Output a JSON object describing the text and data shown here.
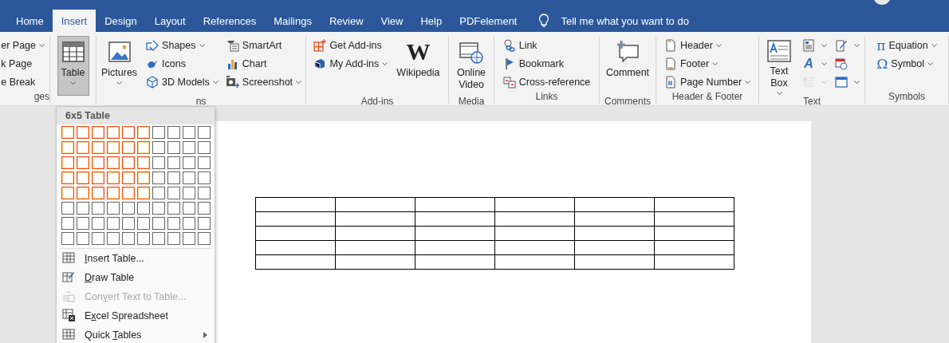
{
  "tabs": [
    {
      "label": "Home",
      "selected": false
    },
    {
      "label": "Insert",
      "selected": true
    },
    {
      "label": "Design",
      "selected": false
    },
    {
      "label": "Layout",
      "selected": false
    },
    {
      "label": "References",
      "selected": false
    },
    {
      "label": "Mailings",
      "selected": false
    },
    {
      "label": "Review",
      "selected": false
    },
    {
      "label": "View",
      "selected": false
    },
    {
      "label": "Help",
      "selected": false
    },
    {
      "label": "PDFelement",
      "selected": false
    }
  ],
  "tell_me": {
    "placeholder": "Tell me what you want to do"
  },
  "ribbon": {
    "groups": [
      {
        "label": "ges",
        "columns": [
          [
            {
              "kind": "small",
              "label": "er Page",
              "dropdown": true
            },
            {
              "kind": "small",
              "label": "k Page",
              "dropdown": false
            },
            {
              "kind": "small",
              "label": "e Break",
              "dropdown": false
            }
          ]
        ]
      },
      {
        "columns": [
          [
            {
              "kind": "large",
              "label": "Table",
              "dropdown": true,
              "pressed": true
            }
          ]
        ]
      },
      {
        "label": "ns",
        "columns": [
          [
            {
              "kind": "large",
              "label": "Pictures",
              "dropdown": true,
              "pressed": false
            }
          ],
          [
            {
              "kind": "small",
              "label": "Shapes",
              "dropdown": true
            },
            {
              "kind": "small",
              "label": "Icons",
              "dropdown": false
            },
            {
              "kind": "small",
              "label": "3D Models",
              "dropdown": true
            }
          ],
          [
            {
              "kind": "small",
              "label": "SmartArt",
              "dropdown": false
            },
            {
              "kind": "small",
              "label": "Chart",
              "dropdown": false
            },
            {
              "kind": "small",
              "label": "Screenshot",
              "dropdown": true
            }
          ]
        ]
      },
      {
        "label": "Add-ins",
        "columns": [
          [
            {
              "kind": "small",
              "label": "Get Add-ins",
              "dropdown": false
            },
            {
              "kind": "small",
              "label": "My Add-ins",
              "dropdown": true
            }
          ],
          [
            {
              "kind": "large",
              "label": "Wikipedia",
              "glyph": "W",
              "dropdown": false,
              "pressed": false
            }
          ]
        ]
      },
      {
        "label": "Media",
        "columns": [
          [
            {
              "kind": "large",
              "label": "Online Video",
              "dropdown": false,
              "pressed": false
            }
          ]
        ]
      },
      {
        "label": "Links",
        "columns": [
          [
            {
              "kind": "small",
              "label": "Link",
              "dropdown": false
            },
            {
              "kind": "small",
              "label": "Bookmark",
              "dropdown": false
            },
            {
              "kind": "small",
              "label": "Cross-reference",
              "dropdown": false
            }
          ]
        ]
      },
      {
        "label": "Comments",
        "columns": [
          [
            {
              "kind": "large",
              "label": "Comment",
              "dropdown": false,
              "pressed": false
            }
          ]
        ]
      },
      {
        "label": "Header & Footer",
        "columns": [
          [
            {
              "kind": "small",
              "label": "Header",
              "dropdown": true
            },
            {
              "kind": "small",
              "label": "Footer",
              "dropdown": true
            },
            {
              "kind": "small",
              "label": "Page Number",
              "dropdown": true
            }
          ]
        ]
      },
      {
        "label": "Text",
        "columns": [
          [
            {
              "kind": "large",
              "label": "Text Box",
              "dropdown": true,
              "pressed": false
            }
          ],
          [
            {
              "kind": "icon",
              "dropdown": true,
              "disabled": false
            },
            {
              "kind": "icon",
              "glyph": "A",
              "dropdown": true,
              "disabled": false
            },
            {
              "kind": "icon",
              "dropdown": true,
              "disabled": true
            }
          ],
          [
            {
              "kind": "icon",
              "dropdown": true,
              "disabled": false
            },
            {
              "kind": "icon",
              "dropdown": false,
              "disabled": false
            },
            {
              "kind": "icon",
              "dropdown": true,
              "disabled": false
            }
          ]
        ]
      },
      {
        "label": "Symbols",
        "columns": [
          [
            {
              "kind": "small",
              "label": "Equation",
              "glyph": "π",
              "dropdown": true
            },
            {
              "kind": "small",
              "label": "Symbol",
              "glyph": "Ω",
              "dropdown": true
            }
          ]
        ]
      }
    ]
  },
  "table_menu": {
    "title": "6x5 Table",
    "grid": [
      [
        {
          "selected": true
        },
        {
          "selected": true
        },
        {
          "selected": true
        },
        {
          "selected": true
        },
        {
          "selected": true
        },
        {
          "selected": true
        },
        {
          "selected": false
        },
        {
          "selected": false
        },
        {
          "selected": false
        },
        {
          "selected": false
        }
      ],
      [
        {
          "selected": true
        },
        {
          "selected": true
        },
        {
          "selected": true
        },
        {
          "selected": true
        },
        {
          "selected": true
        },
        {
          "selected": true
        },
        {
          "selected": false
        },
        {
          "selected": false
        },
        {
          "selected": false
        },
        {
          "selected": false
        }
      ],
      [
        {
          "selected": true
        },
        {
          "selected": true
        },
        {
          "selected": true
        },
        {
          "selected": true
        },
        {
          "selected": true
        },
        {
          "selected": true
        },
        {
          "selected": false
        },
        {
          "selected": false
        },
        {
          "selected": false
        },
        {
          "selected": false
        }
      ],
      [
        {
          "selected": true
        },
        {
          "selected": true
        },
        {
          "selected": true
        },
        {
          "selected": true
        },
        {
          "selected": true
        },
        {
          "selected": true
        },
        {
          "selected": false
        },
        {
          "selected": false
        },
        {
          "selected": false
        },
        {
          "selected": false
        }
      ],
      [
        {
          "selected": true
        },
        {
          "selected": true
        },
        {
          "selected": true
        },
        {
          "selected": true
        },
        {
          "selected": true
        },
        {
          "selected": true
        },
        {
          "selected": false
        },
        {
          "selected": false
        },
        {
          "selected": false
        },
        {
          "selected": false
        }
      ],
      [
        {
          "selected": false
        },
        {
          "selected": false
        },
        {
          "selected": false
        },
        {
          "selected": false
        },
        {
          "selected": false
        },
        {
          "selected": false
        },
        {
          "selected": false
        },
        {
          "selected": false
        },
        {
          "selected": false
        },
        {
          "selected": false
        }
      ],
      [
        {
          "selected": false
        },
        {
          "selected": false
        },
        {
          "selected": false
        },
        {
          "selected": false
        },
        {
          "selected": false
        },
        {
          "selected": false
        },
        {
          "selected": false
        },
        {
          "selected": false
        },
        {
          "selected": false
        },
        {
          "selected": false
        }
      ],
      [
        {
          "selected": false
        },
        {
          "selected": false
        },
        {
          "selected": false
        },
        {
          "selected": false
        },
        {
          "selected": false
        },
        {
          "selected": false
        },
        {
          "selected": false
        },
        {
          "selected": false
        },
        {
          "selected": false
        },
        {
          "selected": false
        }
      ]
    ],
    "items": [
      {
        "kind": "item",
        "key": "I",
        "after": "nsert Table...",
        "disabled": false
      },
      {
        "kind": "item",
        "key": "D",
        "after": "raw Table",
        "disabled": false
      },
      {
        "kind": "item",
        "before": "Con",
        "key": "v",
        "after": "ert Text to Table...",
        "disabled": true
      },
      {
        "kind": "item",
        "before": "E",
        "key": "x",
        "after": "cel Spreadsheet",
        "disabled": false
      },
      {
        "kind": "submenu",
        "before": "Quick ",
        "key": "T",
        "after": "ables",
        "disabled": false
      }
    ]
  },
  "document": {
    "table": [
      {
        "cells": [
          {
            "kind": "blank"
          },
          {
            "kind": "blank"
          },
          {
            "kind": "blank"
          },
          {
            "kind": "blank"
          },
          {
            "kind": "blank"
          },
          {
            "kind": "blank"
          }
        ]
      },
      {
        "cells": [
          {
            "kind": "blank"
          },
          {
            "kind": "blank"
          },
          {
            "kind": "blank"
          },
          {
            "kind": "blank"
          },
          {
            "kind": "blank"
          },
          {
            "kind": "blank"
          }
        ]
      },
      {
        "cells": [
          {
            "kind": "blank"
          },
          {
            "kind": "blank"
          },
          {
            "kind": "blank"
          },
          {
            "kind": "blank"
          },
          {
            "kind": "blank"
          },
          {
            "kind": "blank"
          }
        ]
      },
      {
        "cells": [
          {
            "kind": "blank"
          },
          {
            "kind": "blank"
          },
          {
            "kind": "blank"
          },
          {
            "kind": "blank"
          },
          {
            "kind": "blank"
          },
          {
            "kind": "blank"
          }
        ]
      },
      {
        "cells": [
          {
            "kind": "blank"
          },
          {
            "kind": "blank"
          },
          {
            "kind": "blank"
          },
          {
            "kind": "blank"
          },
          {
            "kind": "blank"
          },
          {
            "kind": "blank"
          }
        ]
      }
    ]
  }
}
